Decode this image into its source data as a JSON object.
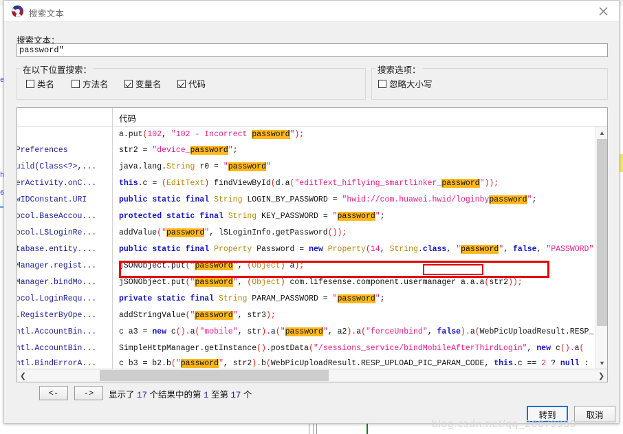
{
  "window": {
    "title": "搜索文本",
    "app_icon": "app-logo-icon",
    "close_icon": "close-icon"
  },
  "search": {
    "label": "搜索文本：",
    "value": "password\"",
    "placeholder": ""
  },
  "locations_group": {
    "title": "在以下位置搜索：",
    "checkboxes": [
      {
        "label": "类名",
        "checked": false
      },
      {
        "label": "方法名",
        "checked": false
      },
      {
        "label": "变量名",
        "checked": true
      },
      {
        "label": "代码",
        "checked": true
      }
    ]
  },
  "options_group": {
    "title": "搜索选项：",
    "checkboxes": [
      {
        "label": "忽略大小写",
        "checked": false
      }
    ]
  },
  "results": {
    "columns": [
      "",
      "代码"
    ],
    "left_column": [
      "",
      "edPreferences",
      ".build(Class<?>,...",
      "nkerActivity.onC...",
      ".HwIDConstant.URI",
      "otocol.BaseAccou...",
      "otocol.LSLoginRe...",
      "database.entity....",
      "erManager.regist...",
      "erManager.bindMo...",
      "otocol.LoginRequ...",
      "ol.RegisterByOpe...",
      ".intl.AccountBin...",
      ".intl.AccountBin...",
      ".intl.BindErrorA..."
    ],
    "code_lines": [
      "a.put(102, \"102 - Incorrect password\");",
      "str2 = \"device_password\";",
      "java.lang.String r0 = \"password\"",
      "this.c = (EditText) findViewById(d.a(\"editText_hiflying_smartlinker_password\"));",
      "public static final String LOGIN_BY_PASSWORD = \"hwid://com.huawei.hwid/loginbypassword\";",
      "protected static final String KEY_PASSWORD = \"password\";",
      "addValue(\"password\", lSLoginInfo.getPassword());",
      "public static final Property Password = new Property(14, String.class, \"password\", false, \"PASSWORD\"",
      "jSONObject.put(\"password\", (Object) a);",
      "jSONObject.put(\"password\", (Object) com.lifesense.component.usermanager a.a.a(str2));",
      "private static final String PARAM_PASSWORD = \"password\";",
      "addStringValue(\"password\", str3);",
      "c a3 = new c().a(\"mobile\", str).a(\"password\", a2).a(\"forceUnbind\", false).a(WebPicUploadResult.RESP_",
      "SimpleHttpManager.getInstance().postData(\"/sessions_service/bindMobileAfterThirdLogin\", new c().a(\"",
      "c b3 = b2.b(\"password\", str2).b(WebPicUploadResult.RESP_UPLOAD_PIC_PARAM_CODE, this.c == 2 ? null :"
    ],
    "highlight_term": "password",
    "annotation": {
      "boxed_row_index": 9,
      "boxed_word": "usermanager",
      "box_color": "#e20000"
    },
    "highlight_color": "#ffb71a"
  },
  "navigation": {
    "prev_label": "<-",
    "next_label": "->",
    "status_prefix": "显示了 ",
    "total": "17",
    "status_mid1": " 个结果中的第 ",
    "from": "1",
    "status_mid2": " 至第 ",
    "to": "17",
    "status_suffix": " 个"
  },
  "footer": {
    "goto_label": "转到",
    "cancel_label": "取消"
  },
  "watermark": "blog.csdn.net/qq_26079939",
  "background": {
    "code_fragments": [
      "ee",
      "hn",
      "6]"
    ],
    "marker_color": "#f3e96a"
  }
}
